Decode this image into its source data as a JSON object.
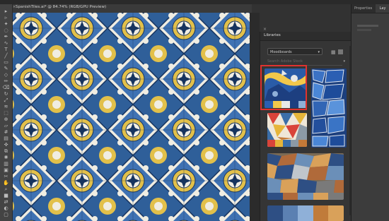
{
  "document_tab": {
    "title": "SpanishTiles.ai* @ 84.74% (RGB/GPU Preview)"
  },
  "tools": [
    "selection-tool",
    "direct-selection-tool",
    "magic-wand-tool",
    "lasso-tool",
    "pen-tool",
    "curvature-tool",
    "type-tool",
    "line-tool",
    "rectangle-tool",
    "paintbrush-tool",
    "shaper-tool",
    "pencil-tool",
    "eraser-tool",
    "rotate-tool",
    "scale-tool",
    "width-tool",
    "free-transform-tool",
    "shape-builder-tool",
    "perspective-tool",
    "mesh-tool",
    "gradient-tool",
    "eyedropper-tool",
    "blend-tool",
    "symbol-sprayer-tool",
    "graph-tool",
    "artboard-tool",
    "slice-tool",
    "hand-tool",
    "zoom-tool",
    "fill-stroke",
    "swap-colors",
    "drawing-modes",
    "screen-mode"
  ],
  "libraries_panel": {
    "title": "Libraries",
    "library_select": "Moodboards",
    "search_placeholder": "Search Adobe Stock",
    "cards": [
      {
        "name": "mosaic-blue-yellow",
        "swatches": [
          "#2b5fb3",
          "#f2c84b",
          "#e8e8e8",
          "#1d3f80",
          "#8fb0d8"
        ]
      },
      {
        "name": "blue-mosaic-tiles",
        "swatches": []
      },
      {
        "name": "colorful-triangles",
        "swatches": [
          "#d9443a",
          "#e6b53a",
          "#3b6ea8",
          "#8c9aa6",
          "#c47a38"
        ]
      },
      {
        "name": "trencadis-mosaic",
        "swatches": [
          "#2e4f84",
          "#b06a3a",
          "#6b8fb8",
          "#d9a15a",
          "#7a7a7a"
        ]
      },
      {
        "name": "bottom-card",
        "swatches": [
          "#2e4f84",
          "#5b80b2",
          "#8fb0d8",
          "#c07b3a",
          "#d9a15a"
        ]
      }
    ]
  },
  "properties_panel": {
    "tabs": [
      "Properties",
      "Lay"
    ]
  },
  "colors": {
    "tile_blue": "#2f5f99",
    "tile_yellow": "#e2c04a",
    "tile_white": "#f0ede2",
    "tile_navy": "#16335e",
    "highlight": "#e0322f"
  }
}
